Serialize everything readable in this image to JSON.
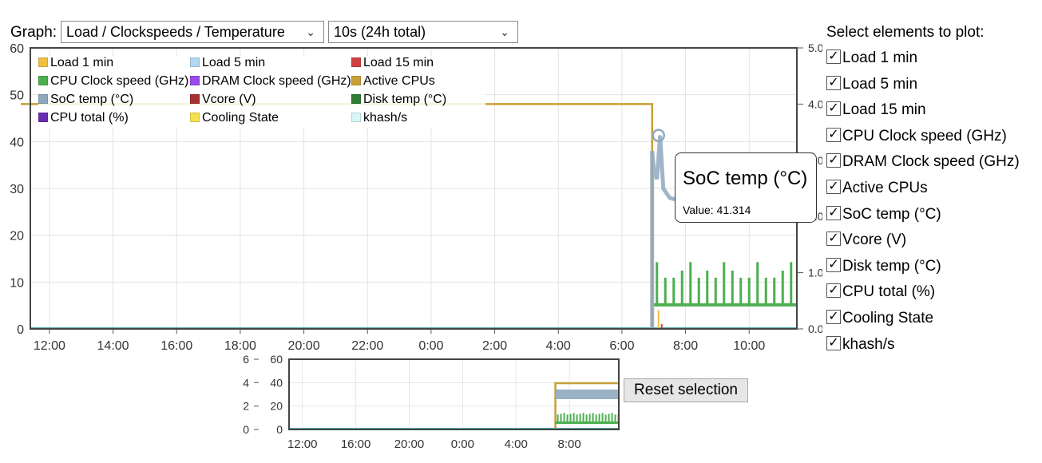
{
  "header": {
    "graph_label": "Graph:",
    "graph_select": "Load / Clockspeeds / Temperature",
    "interval_select": "10s (24h total)"
  },
  "legend": [
    {
      "label": "Load 1 min",
      "color": "#f0c040"
    },
    {
      "label": "Load 5 min",
      "color": "#b0d8f0"
    },
    {
      "label": "Load 15 min",
      "color": "#d04040"
    },
    {
      "label": "CPU Clock speed (GHz)",
      "color": "#4caf50"
    },
    {
      "label": "DRAM Clock speed (GHz)",
      "color": "#9c4af0"
    },
    {
      "label": "Active CPUs",
      "color": "#c8a038"
    },
    {
      "label": "SoC temp (°C)",
      "color": "#8fa8c0"
    },
    {
      "label": "Vcore (V)",
      "color": "#a83232"
    },
    {
      "label": "Disk temp (°C)",
      "color": "#2e7d32"
    },
    {
      "label": "CPU total (%)",
      "color": "#6a2cb0"
    },
    {
      "label": "Cooling State",
      "color": "#f5e050"
    },
    {
      "label": "khash/s",
      "color": "#d8f8f8"
    }
  ],
  "chart_data": {
    "type": "line",
    "y_left": {
      "min": 0,
      "max": 60,
      "ticks": [
        "0",
        "10",
        "20",
        "30",
        "40",
        "50",
        "60"
      ]
    },
    "y_right": {
      "min": 0,
      "max": 5,
      "ticks": [
        "0.0",
        "1.0",
        "2.0",
        "3.0",
        "4.0",
        "5.0"
      ]
    },
    "x_ticks": [
      "12:00",
      "14:00",
      "16:00",
      "18:00",
      "20:00",
      "22:00",
      "0:00",
      "2:00",
      "4:00",
      "6:00",
      "8:00",
      "10:00"
    ],
    "series": [
      {
        "name": "Active CPUs",
        "axis": "right",
        "points": [
          [
            6.95,
            0
          ],
          [
            6.95,
            4
          ],
          [
            11.1,
            4
          ]
        ]
      },
      {
        "name": "SoC temp (°C)",
        "axis": "left",
        "points": [
          [
            6.95,
            0
          ],
          [
            6.95,
            38
          ],
          [
            7.0,
            34
          ],
          [
            7.1,
            32
          ],
          [
            7.2,
            41.3
          ],
          [
            7.3,
            30
          ],
          [
            7.5,
            28
          ],
          [
            8.0,
            27
          ],
          [
            9.0,
            28
          ],
          [
            10.0,
            27.5
          ],
          [
            11.1,
            28
          ]
        ]
      },
      {
        "name": "CPU Clock speed (GHz)",
        "axis": "right",
        "note_spikes": true
      }
    ],
    "marker": {
      "series": "SoC temp (°C)",
      "time": "7:10",
      "value": 41.314
    }
  },
  "tooltip": {
    "title": "SoC temp (°C)",
    "value_text": "Value: 41.314"
  },
  "navigator": {
    "y_left_ticks": [
      "0",
      "2",
      "4",
      "6"
    ],
    "y_right_ticks": [
      "0",
      "20",
      "40",
      "60"
    ],
    "x_ticks": [
      "12:00",
      "16:00",
      "20:00",
      "0:00",
      "4:00",
      "8:00"
    ]
  },
  "reset_label": "Reset selection",
  "sidebar": {
    "title": "Select elements to plot:",
    "items": [
      "Load 1 min",
      "Load 5 min",
      "Load 15 min",
      "CPU Clock speed (GHz)",
      "DRAM Clock speed (GHz)",
      "Active CPUs",
      "SoC temp (°C)",
      "Vcore (V)",
      "Disk temp (°C)",
      "CPU total (%)",
      "Cooling State",
      "khash/s"
    ]
  }
}
